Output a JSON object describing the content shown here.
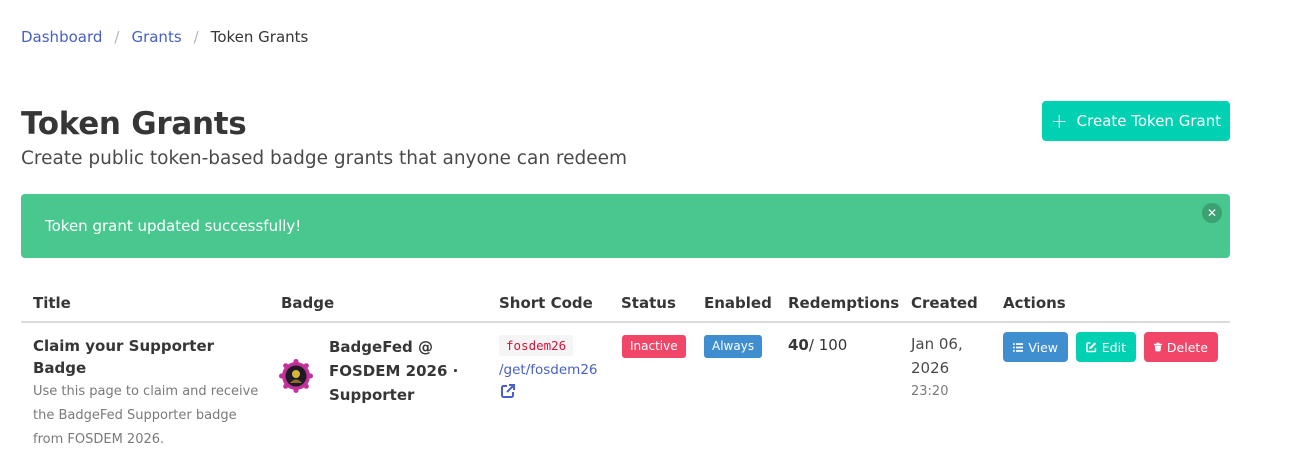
{
  "breadcrumb": {
    "items": [
      "Dashboard",
      "Grants"
    ],
    "current": "Token Grants",
    "separator": "/"
  },
  "page": {
    "title": "Token Grants",
    "subtitle": "Create public token-based badge grants that anyone can redeem"
  },
  "create_button": {
    "label": "Create Token Grant",
    "icon": "plus-icon"
  },
  "notification": {
    "message": "Token grant updated successfully!"
  },
  "table": {
    "headers": [
      "Title",
      "Badge",
      "Short Code",
      "Status",
      "Enabled",
      "Redemptions",
      "Created",
      "Actions"
    ],
    "rows": [
      {
        "title": "Claim your Supporter Badge",
        "description": "Use this page to claim and receive the BadgeFed Supporter badge from FOSDEM 2026.",
        "badge_name": "BadgeFed @ FOSDEM 2026 · Supporter",
        "badge_icon": "badge-image",
        "short_code": "fosdem26",
        "short_path": "/get/fosdem26",
        "status": "Inactive",
        "enabled": "Always",
        "redemptions_count": "40",
        "redemptions_limit": "/ 100",
        "created_date": "Jan 06, 2026",
        "created_time": "23:20",
        "actions": {
          "view": "View",
          "edit": "Edit",
          "delete": "Delete"
        }
      }
    ]
  },
  "colors": {
    "primary": "#00d1b2",
    "success": "#48c78e",
    "info": "#3e8ed0",
    "danger": "#f14668",
    "link": "#485fc7",
    "code": "#da1039"
  }
}
